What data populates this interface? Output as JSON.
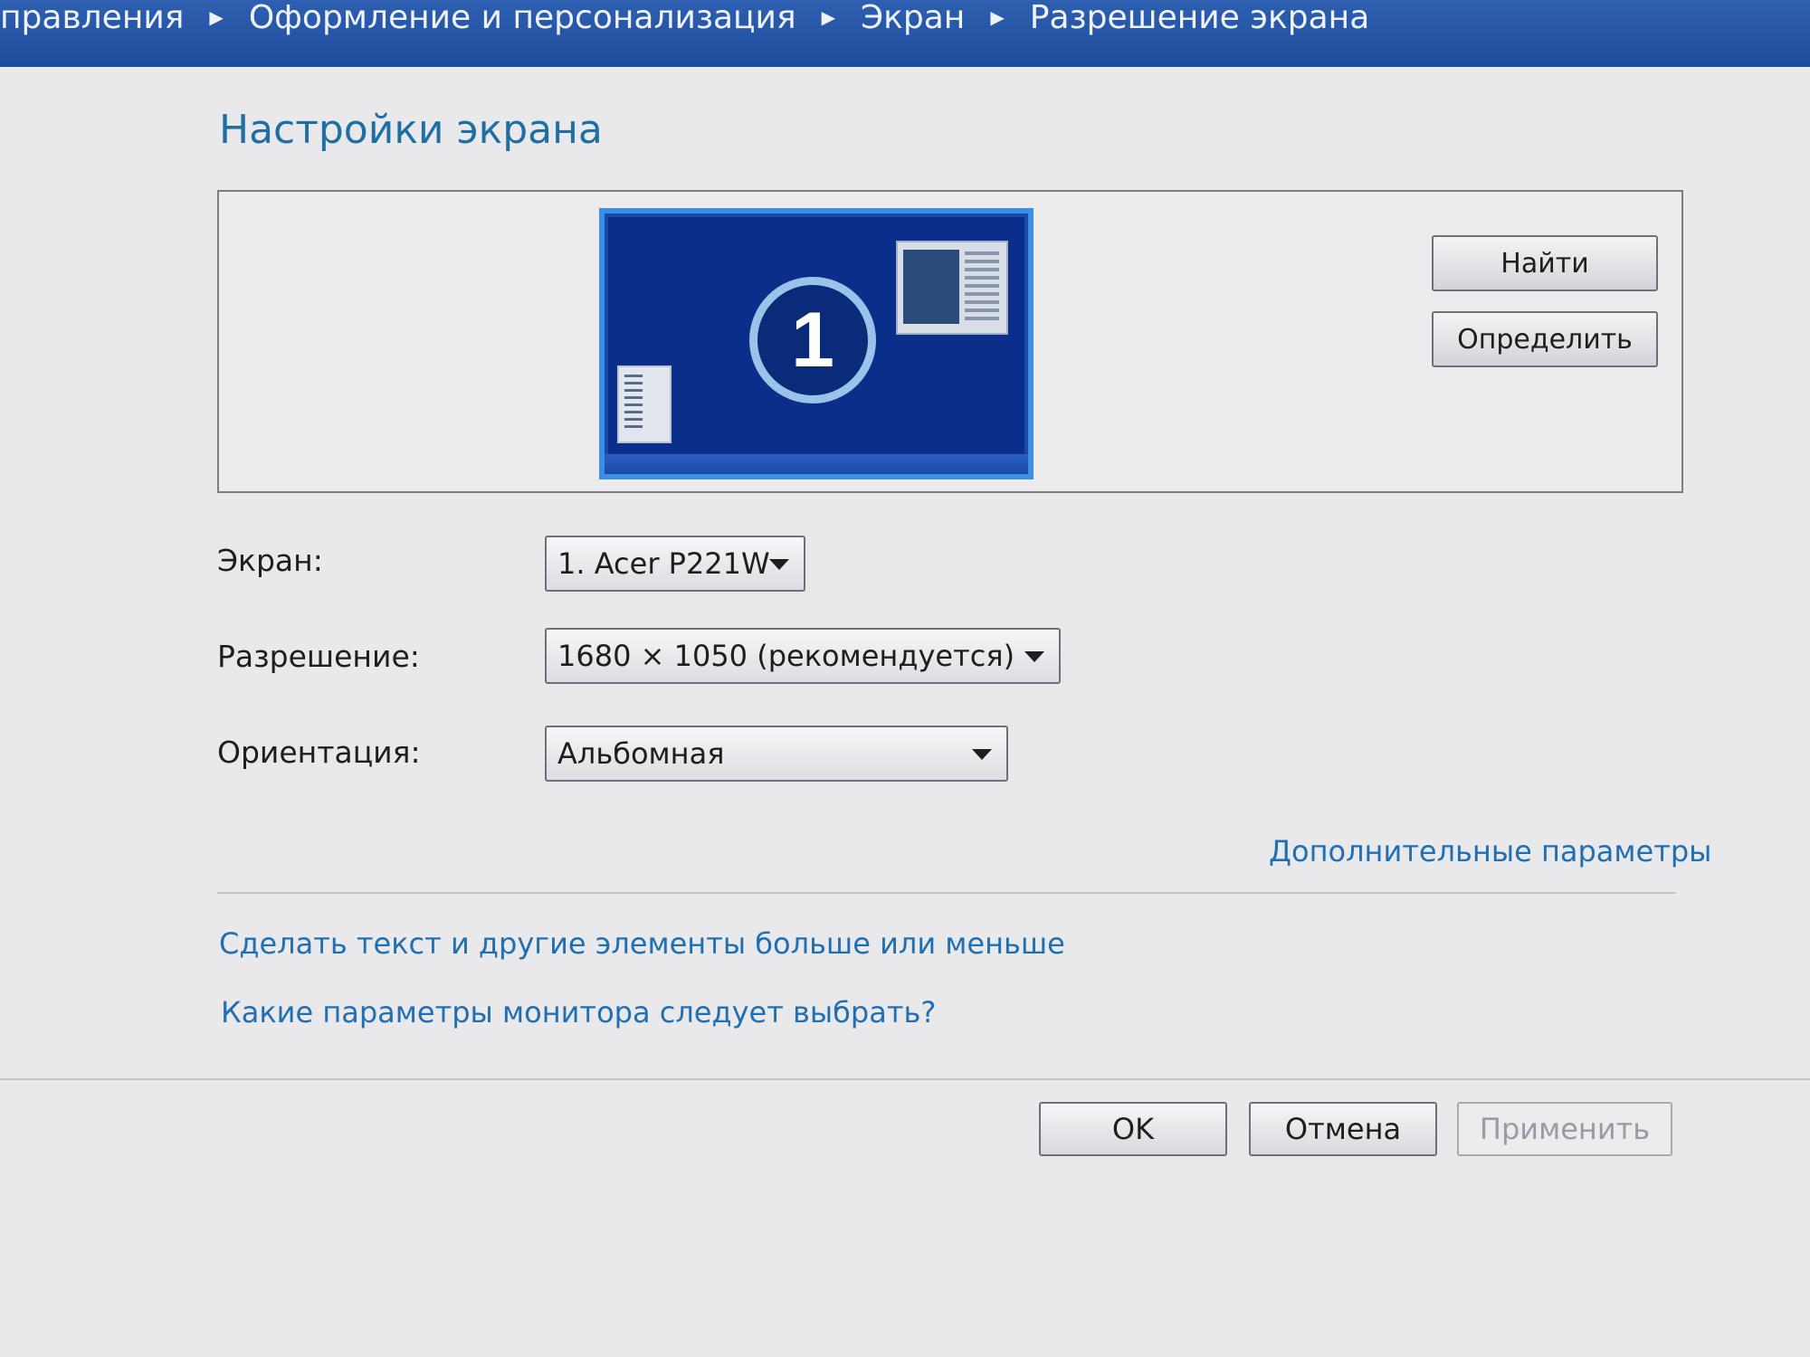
{
  "breadcrumb": {
    "items": [
      "правления",
      "Оформление и персонализация",
      "Экран",
      "Разрешение экрана"
    ]
  },
  "page": {
    "title": "Настройки экрана"
  },
  "preview": {
    "monitor_number": "1",
    "find_button": "Найти",
    "detect_button": "Определить"
  },
  "form": {
    "screen_label": "Экран:",
    "screen_value": "1. Acer P221W",
    "resolution_label": "Разрешение:",
    "resolution_value": "1680 × 1050 (рекомендуется)",
    "orientation_label": "Ориентация:",
    "orientation_value": "Альбомная"
  },
  "links": {
    "advanced": "Дополнительные параметры",
    "text_size": "Сделать текст и другие элементы больше или меньше",
    "which_settings": "Какие параметры монитора следует выбрать?"
  },
  "buttons": {
    "ok": "OK",
    "cancel": "Отмена",
    "apply": "Применить"
  },
  "colors": {
    "accent_link": "#1f6fb2",
    "title": "#1f6fa3",
    "topbar": "#2f5fb0",
    "monitor_bg": "#0b2e8a"
  }
}
